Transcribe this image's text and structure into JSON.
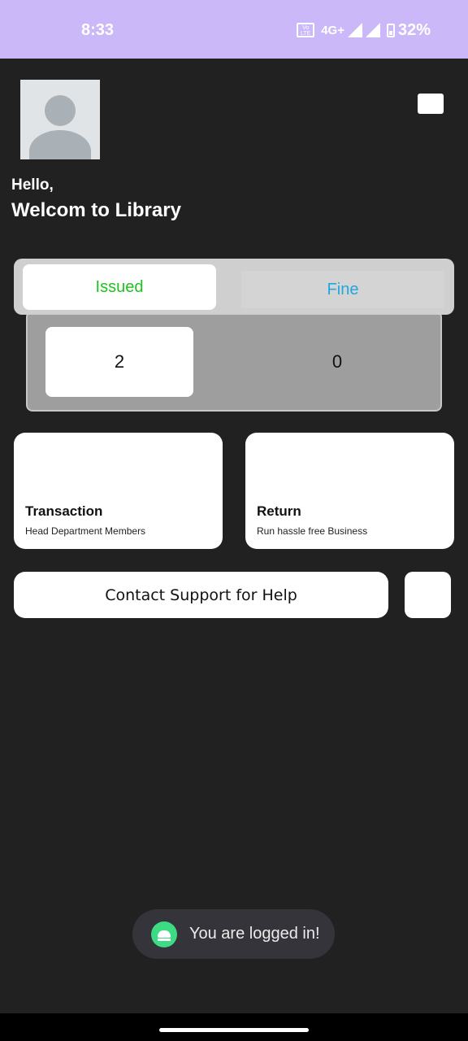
{
  "status_bar": {
    "time": "8:33",
    "volte": "Vo LTE",
    "network": "4G+",
    "battery": "32%",
    "icons": [
      "volte-icon",
      "signal-icon",
      "signal-icon",
      "battery-icon"
    ]
  },
  "header": {
    "avatar_icon": "avatar-placeholder-icon",
    "menu_icon": "menu-icon",
    "greeting": "Hello,",
    "welcome": "Welcom to Library"
  },
  "tabs": [
    {
      "label": "Issued",
      "selected": true
    },
    {
      "label": "Fine",
      "selected": false
    }
  ],
  "stats": {
    "issued_count": "2",
    "fine_count": "0"
  },
  "cards": [
    {
      "title": "Transaction",
      "subtitle": "Head Department Members"
    },
    {
      "title": "Return",
      "subtitle": "Run hassle free Business"
    }
  ],
  "support": {
    "label": "Contact Support for Help"
  },
  "toast": {
    "icon": "android-icon",
    "message": "You are logged in!"
  },
  "colors": {
    "status_bar": "#cbb8f8",
    "background": "#212121",
    "issued_text": "#1ec21e",
    "fine_text": "#22a7e0",
    "toast_icon": "#3ddc84"
  }
}
